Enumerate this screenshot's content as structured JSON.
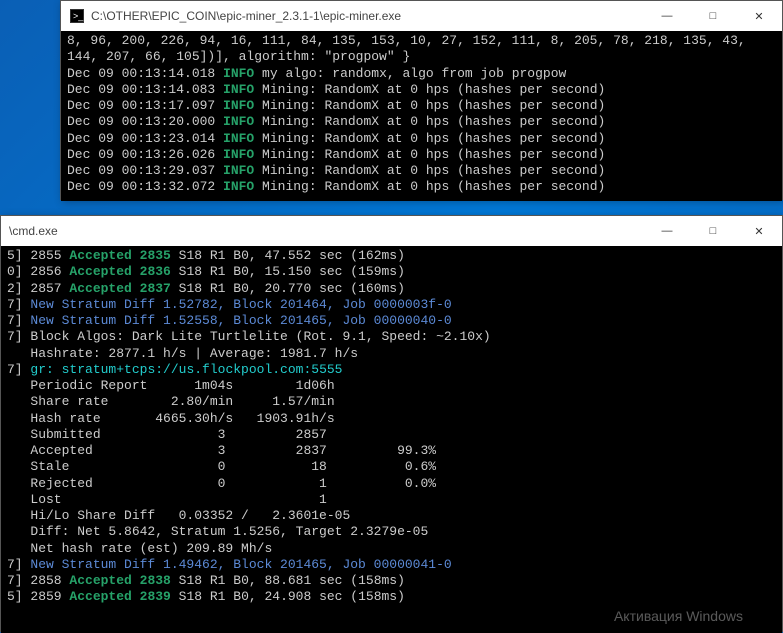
{
  "window1": {
    "title": "C:\\OTHER\\EPIC_COIN\\epic-miner_2.3.1-1\\epic-miner.exe",
    "header_line1": "8, 96, 200, 226, 94, 16, 111, 84, 135, 153, 10, 27, 152, 111, 8, 205, 78, 218, 135, 43,",
    "header_line2": "144, 207, 66, 105])], algorithm: \"progpow\" }",
    "lines": [
      {
        "ts": "Dec 09 00:13:14.018",
        "level": "INFO",
        "msg": "my algo: randomx, algo from job progpow"
      },
      {
        "ts": "Dec 09 00:13:14.083",
        "level": "INFO",
        "msg": "Mining: RandomX at 0 hps (hashes per second)"
      },
      {
        "ts": "Dec 09 00:13:17.097",
        "level": "INFO",
        "msg": "Mining: RandomX at 0 hps (hashes per second)"
      },
      {
        "ts": "Dec 09 00:13:20.000",
        "level": "INFO",
        "msg": "Mining: RandomX at 0 hps (hashes per second)"
      },
      {
        "ts": "Dec 09 00:13:23.014",
        "level": "INFO",
        "msg": "Mining: RandomX at 0 hps (hashes per second)"
      },
      {
        "ts": "Dec 09 00:13:26.026",
        "level": "INFO",
        "msg": "Mining: RandomX at 0 hps (hashes per second)"
      },
      {
        "ts": "Dec 09 00:13:29.037",
        "level": "INFO",
        "msg": "Mining: RandomX at 0 hps (hashes per second)"
      },
      {
        "ts": "Dec 09 00:13:32.072",
        "level": "INFO",
        "msg": "Mining: RandomX at 0 hps (hashes per second)"
      }
    ]
  },
  "window2": {
    "title": "\\cmd.exe",
    "accepted_top": [
      {
        "pre": "5] 2855 ",
        "acc": "Accepted",
        "num": " 2835",
        "tail": " S18 R1 B0, 47.552 sec (162ms)"
      },
      {
        "pre": "0] 2856 ",
        "acc": "Accepted",
        "num": " 2836",
        "tail": " S18 R1 B0, 15.150 sec (159ms)"
      },
      {
        "pre": "2] 2857 ",
        "acc": "Accepted",
        "num": " 2837",
        "tail": " S18 R1 B0, 20.770 sec (160ms)"
      }
    ],
    "stratum_top": [
      {
        "pre": "7] ",
        "msg": "New Stratum Diff 1.52782, Block 201464, Job 0000003f-0"
      },
      {
        "pre": "7] ",
        "msg": "New Stratum Diff 1.52558, Block 201465, Job 00000040-0"
      }
    ],
    "block_algos": {
      "pre": "7] ",
      "txt": "Block Algos: Dark Lite Turtlelite (Rot. 9.1, Speed: ~2.10x)"
    },
    "hashrate": "   Hashrate: 2877.1 h/s | Average: 1981.7 h/s",
    "gr": {
      "pre": "7] ",
      "lbl": "gr: ",
      "url": "stratum+tcps://us.flockpool.com:5555"
    },
    "report_header": "   Periodic Report      1m04s        1d06h",
    "rows": [
      "   Share rate        2.80/min     1.57/min",
      "   Hash rate       4665.30h/s   1903.91h/s",
      "   Submitted               3         2857",
      "   Accepted                3         2837         99.3%",
      "   Stale                   0           18          0.6%",
      "   Rejected                0            1          0.0%",
      "   Lost                                 1"
    ],
    "hilo": "   Hi/Lo Share Diff   0.03352 /   2.3601e-05",
    "diff": "   Diff: Net 5.8642, Stratum 1.5256, Target 2.3279e-05",
    "nethash": "   Net hash rate (est) 209.89 Mh/s",
    "stratum_bottom": {
      "pre": "7] ",
      "msg": "New Stratum Diff 1.49462, Block 201465, Job 00000041-0"
    },
    "accepted_bottom": [
      {
        "pre": "7] 2858 ",
        "acc": "Accepted",
        "num": " 2838",
        "tail": " S18 R1 B0, 88.681 sec (158ms)"
      },
      {
        "pre": "5] 2859 ",
        "acc": "Accepted",
        "num": " 2839",
        "tail": " S18 R1 B0, 24.908 sec (158ms)"
      }
    ]
  },
  "watermark": "Активация Windows",
  "controls": {
    "min": "—",
    "max": "□",
    "close": "✕"
  }
}
